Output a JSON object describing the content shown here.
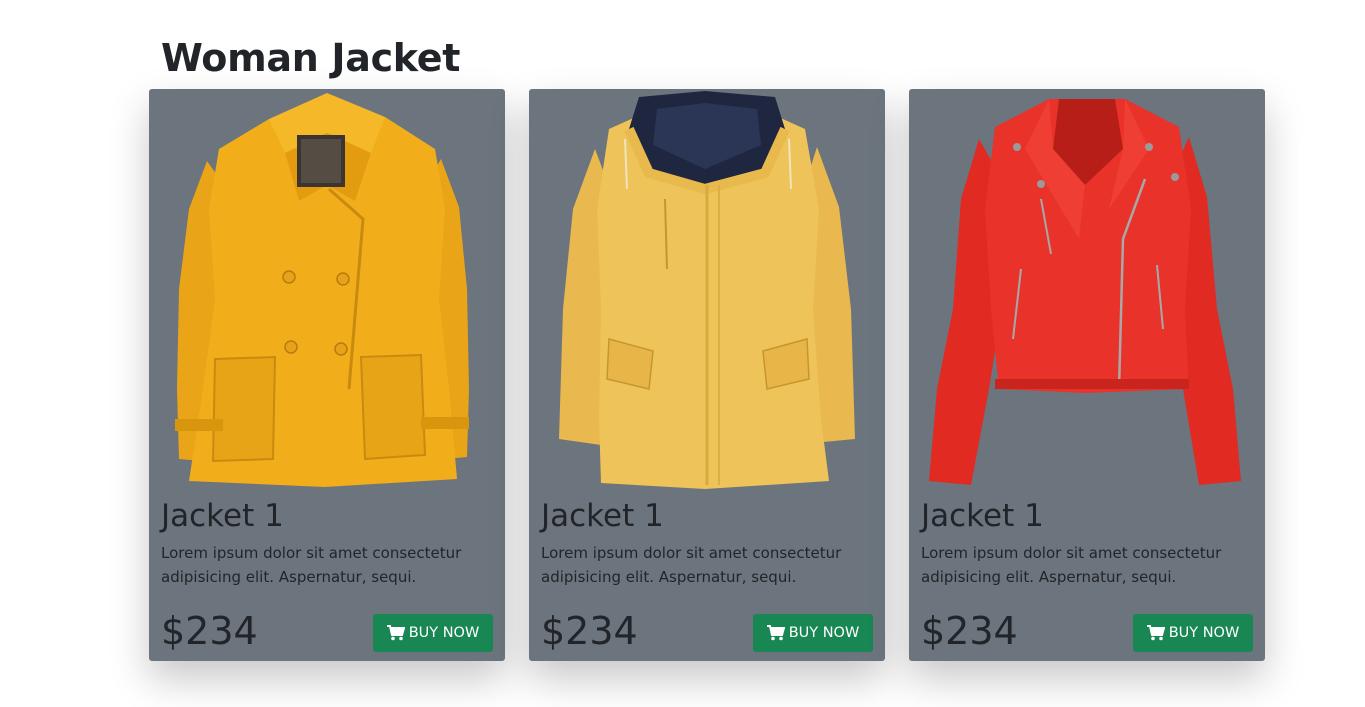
{
  "page": {
    "title": "Woman Jacket"
  },
  "products": [
    {
      "image": "yellow-wool-peacoat",
      "color": "#f2ae1a",
      "title": "Jacket 1",
      "description": "Lorem ipsum dolor sit amet consectetur adipisicing elit. Aspernatur, sequi.",
      "price": "$234",
      "button_label": "BUY NOW",
      "button_icon": "cart-icon"
    },
    {
      "image": "yellow-hooded-rain-jacket",
      "color": "#eec35a",
      "title": "Jacket 1",
      "description": "Lorem ipsum dolor sit amet consectetur adipisicing elit. Aspernatur, sequi.",
      "price": "$234",
      "button_label": "BUY NOW",
      "button_icon": "cart-icon"
    },
    {
      "image": "red-leather-biker-jacket",
      "color": "#e8322a",
      "title": "Jacket 1",
      "description": "Lorem ipsum dolor sit amet consectetur adipisicing elit. Aspernatur, sequi.",
      "price": "$234",
      "button_label": "BUY NOW",
      "button_icon": "cart-icon"
    }
  ],
  "colors": {
    "card_background": "#6c757d",
    "button_success": "#198754",
    "text_dark": "#212529"
  }
}
